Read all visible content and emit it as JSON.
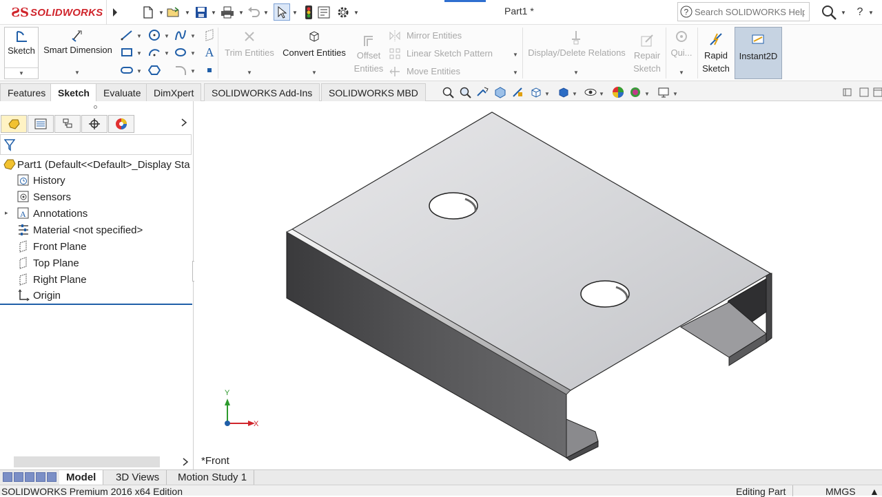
{
  "app": {
    "brand": "SOLIDWORKS",
    "document_title": "Part1 *",
    "search_placeholder": "Search SOLIDWORKS Help",
    "accent_color": "#d0252c"
  },
  "command_manager": {
    "sketch": "Sketch",
    "smart_dimension": "Smart Dimension",
    "trim_entities": "Trim Entities",
    "convert_entities": "Convert Entities",
    "offset_entities_l1": "Offset",
    "offset_entities_l2": "Entities",
    "mirror_entities": "Mirror Entities",
    "linear_sketch_pattern": "Linear Sketch Pattern",
    "move_entities": "Move Entities",
    "display_delete_relations": "Display/Delete Relations",
    "repair_sketch_l1": "Repair",
    "repair_sketch_l2": "Sketch",
    "quick_snaps": "Qui...",
    "rapid_sketch_l1": "Rapid",
    "rapid_sketch_l2": "Sketch",
    "instant2d": "Instant2D"
  },
  "cm_tabs": [
    "Features",
    "Sketch",
    "Evaluate",
    "DimXpert",
    "SOLIDWORKS Add-Ins",
    "SOLIDWORKS MBD"
  ],
  "tree": {
    "root": "Part1  (Default<<Default>_Display Sta",
    "items": [
      "History",
      "Sensors",
      "Annotations",
      "Material <not specified>",
      "Front Plane",
      "Top Plane",
      "Right Plane",
      "Origin"
    ]
  },
  "viewport": {
    "view_name": "*Front",
    "triad_x": "X",
    "triad_y": "Y"
  },
  "bottom_tabs": [
    "Model",
    "3D Views",
    "Motion Study 1"
  ],
  "status": {
    "edition": "SOLIDWORKS Premium 2016 x64 Edition",
    "mode": "Editing Part",
    "units": "MMGS"
  }
}
